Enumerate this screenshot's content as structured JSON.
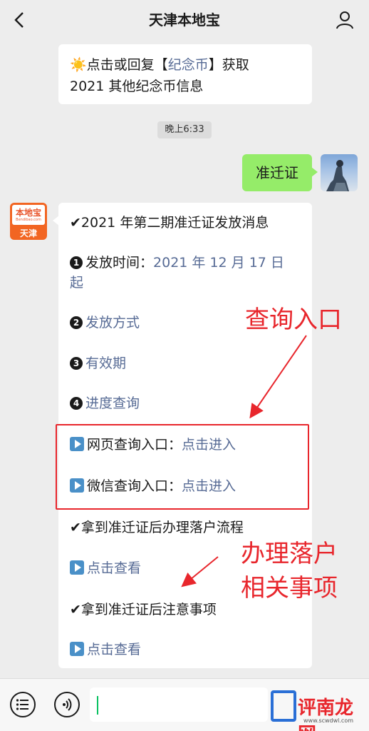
{
  "header": {
    "title": "天津本地宝"
  },
  "messages": {
    "promo": {
      "sun": "☀️",
      "line1_a": "点击或回复【",
      "line1_link": "纪念币",
      "line1_b": "】获取",
      "line2": "2021 其他纪念币信息"
    },
    "timestamp": "晚上6:33",
    "user_msg": "准迁证",
    "bot_avatar": {
      "brand": "本地宝",
      "site": "Bendibao.com",
      "city": "天津"
    },
    "reply": {
      "heading": "✔2021 年第二期准迁证发放消息",
      "item1_num": "1",
      "item1_label": "发放时间：",
      "item1_value": "2021 年 12 月 17 日",
      "item1_value_cont": "起",
      "item2_num": "2",
      "item2_link": "发放方式",
      "item3_num": "3",
      "item3_link": "有效期",
      "item4_num": "4",
      "item4_link": "进度查询",
      "web_label": "网页查询入口：",
      "web_link": "点击进入",
      "wechat_label": "微信查询入口：",
      "wechat_link": "点击进入",
      "settle_heading": "✔拿到准迁证后办理落户流程",
      "settle_link": "点击查看",
      "notes_heading": "✔拿到准迁证后注意事项",
      "notes_link": "点击查看"
    }
  },
  "annotations": {
    "query_entry": "查询入口",
    "settle_line1": "办理落户",
    "settle_line2": "相关事项",
    "color": "#e8262c"
  },
  "watermark": {
    "text": "评南龙网",
    "sub": "www.scwdwl.com"
  }
}
